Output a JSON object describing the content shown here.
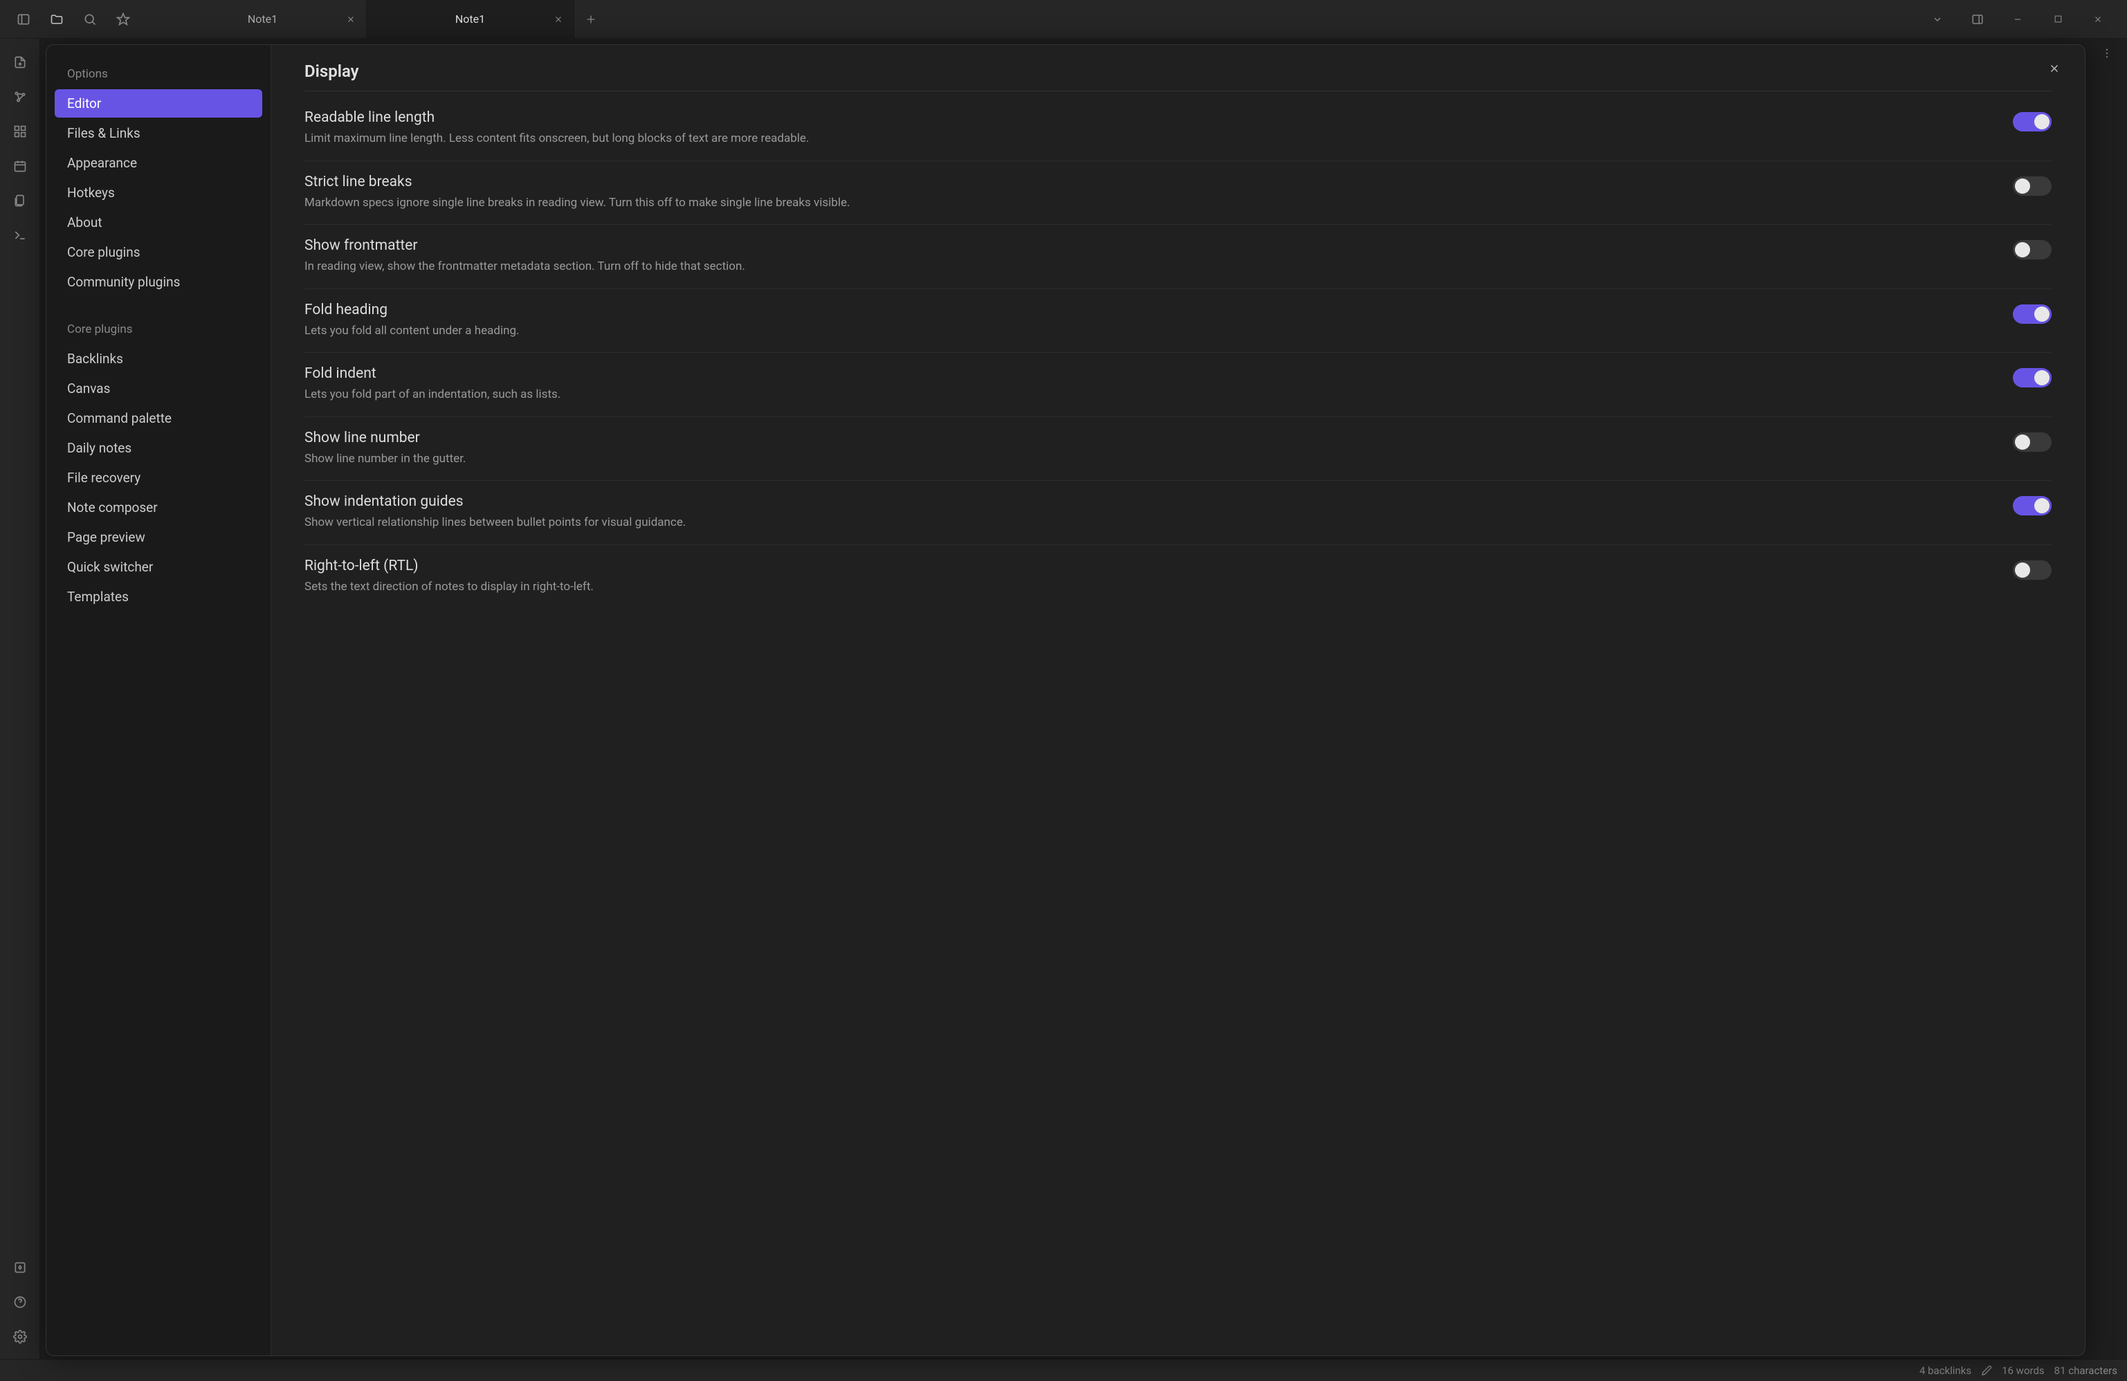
{
  "toolbar": {
    "tabs": [
      {
        "title": "Note1",
        "active": false
      },
      {
        "title": "Note1",
        "active": true
      }
    ]
  },
  "left_rail_icons": [
    "file-plus-icon",
    "graph-icon",
    "apps-icon",
    "calendar-icon",
    "files-icon",
    "terminal-icon"
  ],
  "left_rail_bottom_icons": [
    "vault-icon",
    "help-icon",
    "settings-icon"
  ],
  "settings": {
    "sidebar": {
      "options_header": "Options",
      "options": [
        "Editor",
        "Files & Links",
        "Appearance",
        "Hotkeys",
        "About",
        "Core plugins",
        "Community plugins"
      ],
      "core_plugins_header": "Core plugins",
      "core_plugins": [
        "Backlinks",
        "Canvas",
        "Command palette",
        "Daily notes",
        "File recovery",
        "Note composer",
        "Page preview",
        "Quick switcher",
        "Templates"
      ],
      "selected": "Editor"
    },
    "content": {
      "title": "Display",
      "items": [
        {
          "name": "Readable line length",
          "desc": "Limit maximum line length. Less content fits onscreen, but long blocks of text are more readable.",
          "on": true
        },
        {
          "name": "Strict line breaks",
          "desc": "Markdown specs ignore single line breaks in reading view. Turn this off to make single line breaks visible.",
          "on": false
        },
        {
          "name": "Show frontmatter",
          "desc": "In reading view, show the frontmatter metadata section. Turn off to hide that section.",
          "on": false
        },
        {
          "name": "Fold heading",
          "desc": "Lets you fold all content under a heading.",
          "on": true
        },
        {
          "name": "Fold indent",
          "desc": "Lets you fold part of an indentation, such as lists.",
          "on": true
        },
        {
          "name": "Show line number",
          "desc": "Show line number in the gutter.",
          "on": false
        },
        {
          "name": "Show indentation guides",
          "desc": "Show vertical relationship lines between bullet points for visual guidance.",
          "on": true
        },
        {
          "name": "Right-to-left (RTL)",
          "desc": "Sets the text direction of notes to display in right-to-left.",
          "on": false
        }
      ]
    }
  },
  "status_bar": {
    "backlinks": "4 backlinks",
    "words": "16 words",
    "characters": "81 characters"
  }
}
